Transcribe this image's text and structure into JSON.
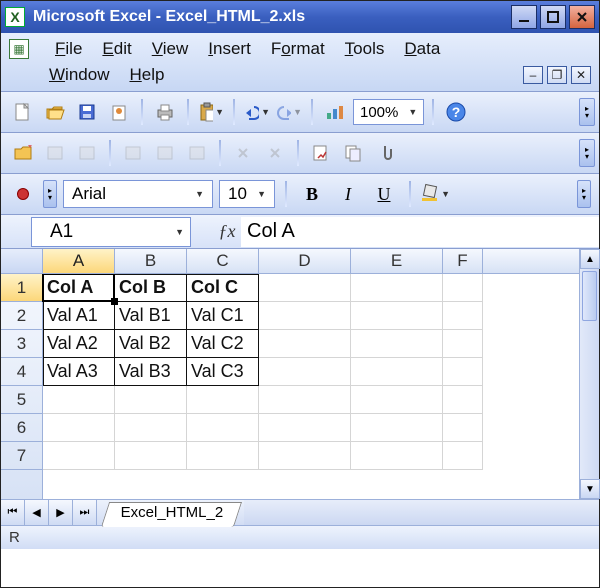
{
  "title": "Microsoft Excel - Excel_HTML_2.xls",
  "menu": {
    "file": "File",
    "edit": "Edit",
    "view": "View",
    "insert": "Insert",
    "format": "Format",
    "tools": "Tools",
    "data": "Data",
    "window": "Window",
    "help": "Help"
  },
  "toolbar": {
    "zoom": "100%"
  },
  "format": {
    "font": "Arial",
    "size": "10",
    "bold": "B",
    "italic": "I",
    "underline": "U"
  },
  "namebox": "A1",
  "formula": "Col A",
  "chart_data": {
    "type": "table",
    "columns": [
      "A",
      "B",
      "C",
      "D",
      "E",
      "F"
    ],
    "visible_rows": [
      1,
      2,
      3,
      4,
      5,
      6,
      7
    ],
    "column_widths": {
      "A": 72,
      "B": 72,
      "C": 72,
      "D": 92,
      "E": 92,
      "F": 40
    },
    "data": {
      "A1": "Col A",
      "B1": "Col B",
      "C1": "Col C",
      "A2": "Val A1",
      "B2": "Val B1",
      "C2": "Val C1",
      "A3": "Val A2",
      "B3": "Val B2",
      "C3": "Val C2",
      "A4": "Val A3",
      "B4": "Val B3",
      "C4": "Val C3"
    },
    "header_row": 1,
    "bordered_range": "A1:C4",
    "active_cell": "A1"
  },
  "sheet": {
    "tab": "Excel_HTML_2"
  },
  "status": "R"
}
